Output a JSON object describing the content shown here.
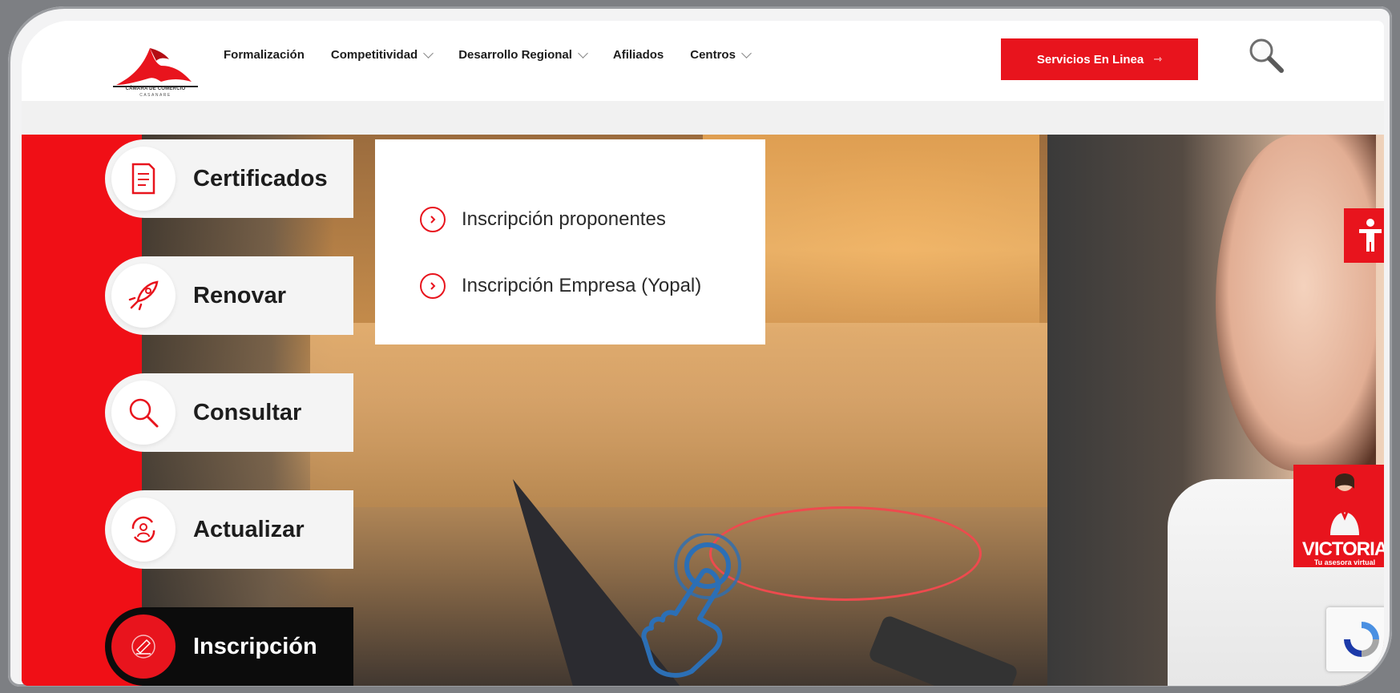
{
  "header": {
    "logo_caption": "CÁMARA DE COMERCIO",
    "logo_sub": "CASANARE",
    "nav": [
      {
        "label": "Formalización",
        "has_dropdown": false
      },
      {
        "label": "Competitividad",
        "has_dropdown": true
      },
      {
        "label": "Desarrollo Regional",
        "has_dropdown": true
      },
      {
        "label": "Afiliados",
        "has_dropdown": false
      },
      {
        "label": "Centros",
        "has_dropdown": true
      }
    ],
    "services_button": {
      "label": "Servicios En Linea",
      "arrow": "⇾"
    },
    "search_icon": "magnifier-icon"
  },
  "services": [
    {
      "label": "Certificados",
      "icon": "document-icon"
    },
    {
      "label": "Renovar",
      "icon": "rocket-icon"
    },
    {
      "label": "Consultar",
      "icon": "search-icon"
    },
    {
      "label": "Actualizar",
      "icon": "user-refresh-icon"
    },
    {
      "label": "Inscripción",
      "icon": "signature-icon",
      "active": true
    }
  ],
  "dropdown": {
    "items": [
      {
        "label": "Inscripción proponentes"
      },
      {
        "label": "Inscripción Empresa (Yopal)"
      }
    ]
  },
  "widgets": {
    "accessibility_icon": "accessibility-icon",
    "assistant": {
      "name": "VICTORIA",
      "subtitle": "Tu asesora virtual"
    },
    "recaptcha_icon": "recaptcha-icon"
  },
  "colors": {
    "brand_red": "#e8141d",
    "active_pill": "#0c0c0c",
    "annotation_red": "#ee4a4e",
    "annotation_blue": "#2c6fb5"
  }
}
